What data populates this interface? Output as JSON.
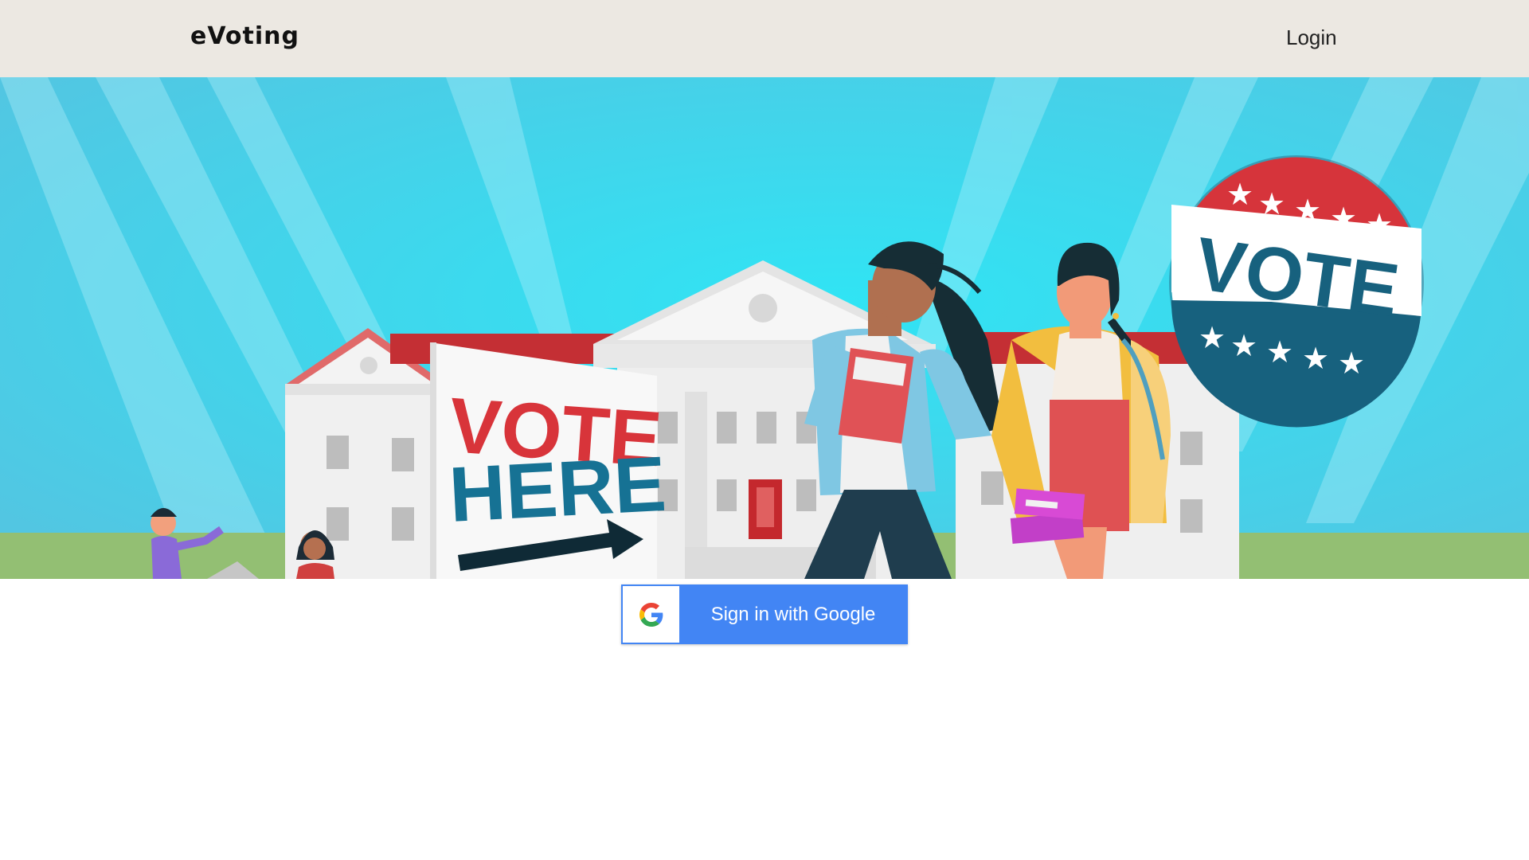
{
  "navbar": {
    "brand": "eVoting",
    "login_label": "Login",
    "background_color": "#ece8e2"
  },
  "hero": {
    "sign_text_line1": "VOTE",
    "sign_text_line2": "HERE",
    "badge_text": "VOTE",
    "sky_color": "#2fd0e8",
    "grass_color": "#93bf73"
  },
  "signin": {
    "label": "Sign in with Google",
    "icon": "google-g-icon",
    "button_color": "#4285f4"
  }
}
